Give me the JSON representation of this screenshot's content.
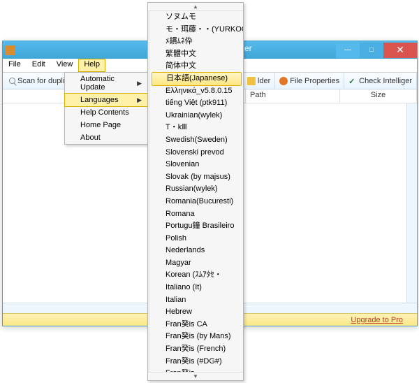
{
  "window": {
    "title_suffix": "er",
    "minimize": "—",
    "maximize": "□",
    "close": "✕"
  },
  "menubar": {
    "file": "File",
    "edit": "Edit",
    "view": "View",
    "help": "Help"
  },
  "toolbar": {
    "scan": "Scan for duplica",
    "folder": "lder",
    "file_props": "File Properties",
    "check_intel": "Check Intelliger"
  },
  "columns": {
    "path": "Path",
    "size": "Size"
  },
  "statusbar": {
    "upgrade": "Upgrade to Pro"
  },
  "help_menu": {
    "automatic_update": "Automatic Update",
    "languages": "Languages",
    "help_contents": "Help Contents",
    "home_page": "Home Page",
    "about": "About"
  },
  "lang_menu": {
    "items": [
      "ソヌムモ",
      "モ・珥藤・・(YURKOG)",
      "ﾒ鏆ﾑﾈ伜",
      "繁體中文",
      "简体中文",
      "日本語(Japanese)",
      "Ελληνικά_v5.8.0.15",
      "tiếng Việt (ptk911)",
      "Ukrainian(wylek)",
      "T・kⅢ",
      "Swedish(Sweden)",
      "Slovenski prevod",
      "Slovenian",
      "Slovak (by majsus)",
      "Russian(wylek)",
      "Romania(Bucuresti)",
      "Romana",
      "Portugu鐘 Brasileiro",
      "Polish",
      "Nederlands",
      "Magyar",
      "Korean (ｽﾑｱﾀｾ・",
      "Italiano (It)",
      "Italian",
      "Hebrew",
      "Fran癸is CA",
      "Fran癸is (by Mans)",
      "Fran癸is (French)",
      "Fran癸is (#DG#)",
      "Fran癸is"
    ],
    "selected_index": 5,
    "scroll_up": "▲",
    "scroll_down": "▼"
  }
}
